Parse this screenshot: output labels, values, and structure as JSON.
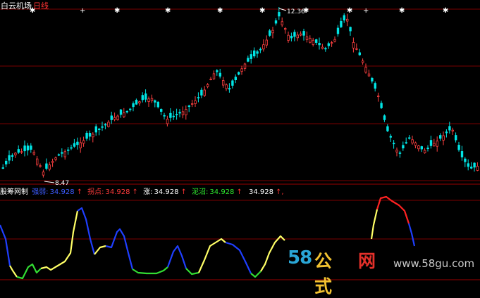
{
  "header": {
    "stock_name": "白云机场",
    "timeframe": "日线"
  },
  "price_chart": {
    "high_label": "12.36",
    "low_label": "8.47",
    "grid_color": "#7a0000",
    "up_color": "#ff4040",
    "down_color": "#00e5e5"
  },
  "indicator": {
    "name": "股筹网制",
    "items": [
      {
        "label": "强弱",
        "value": "34.928",
        "arrow": "↑",
        "color": "#3d5cff"
      },
      {
        "label": "拐点",
        "value": "34.928",
        "arrow": "↑",
        "color": "#ff3b3b"
      },
      {
        "label": "涨",
        "value": "34.928",
        "arrow": "↑",
        "color": "#ffffff"
      },
      {
        "label": "泥沼",
        "value": "34.928",
        "arrow": "↑",
        "color": "#2ee62e"
      },
      {
        "label": "",
        "value": "34.928",
        "arrow": "↑",
        "color": "#ffffff"
      }
    ],
    "line_colors": {
      "yellow": "#ffff66",
      "green": "#33dd33",
      "blue": "#1f3fff",
      "red": "#ff2222"
    }
  },
  "watermark": {
    "number": "58",
    "gongshi": "公式",
    "wang": "网",
    "url": "www.58gu.com"
  }
}
